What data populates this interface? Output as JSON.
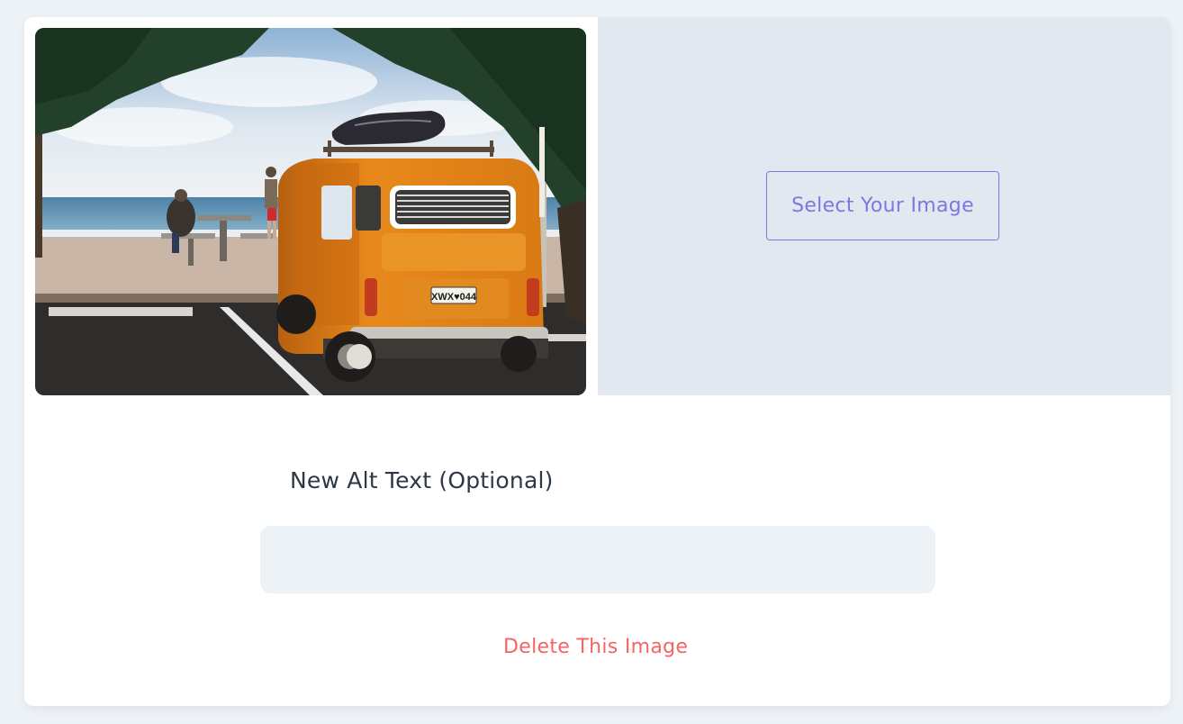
{
  "image_editor": {
    "select_button_label": "Select Your Image",
    "alt_text_label": "New Alt Text (Optional)",
    "alt_text_value": "",
    "alt_text_placeholder": "",
    "delete_label": "Delete This Image",
    "photo_plate": "XWX♥044"
  },
  "colors": {
    "accent": "#7f76df",
    "danger": "#f56565",
    "pane_bg": "#e2e8f0",
    "input_bg": "#edf2f7",
    "van_orange": "#e8891c"
  }
}
